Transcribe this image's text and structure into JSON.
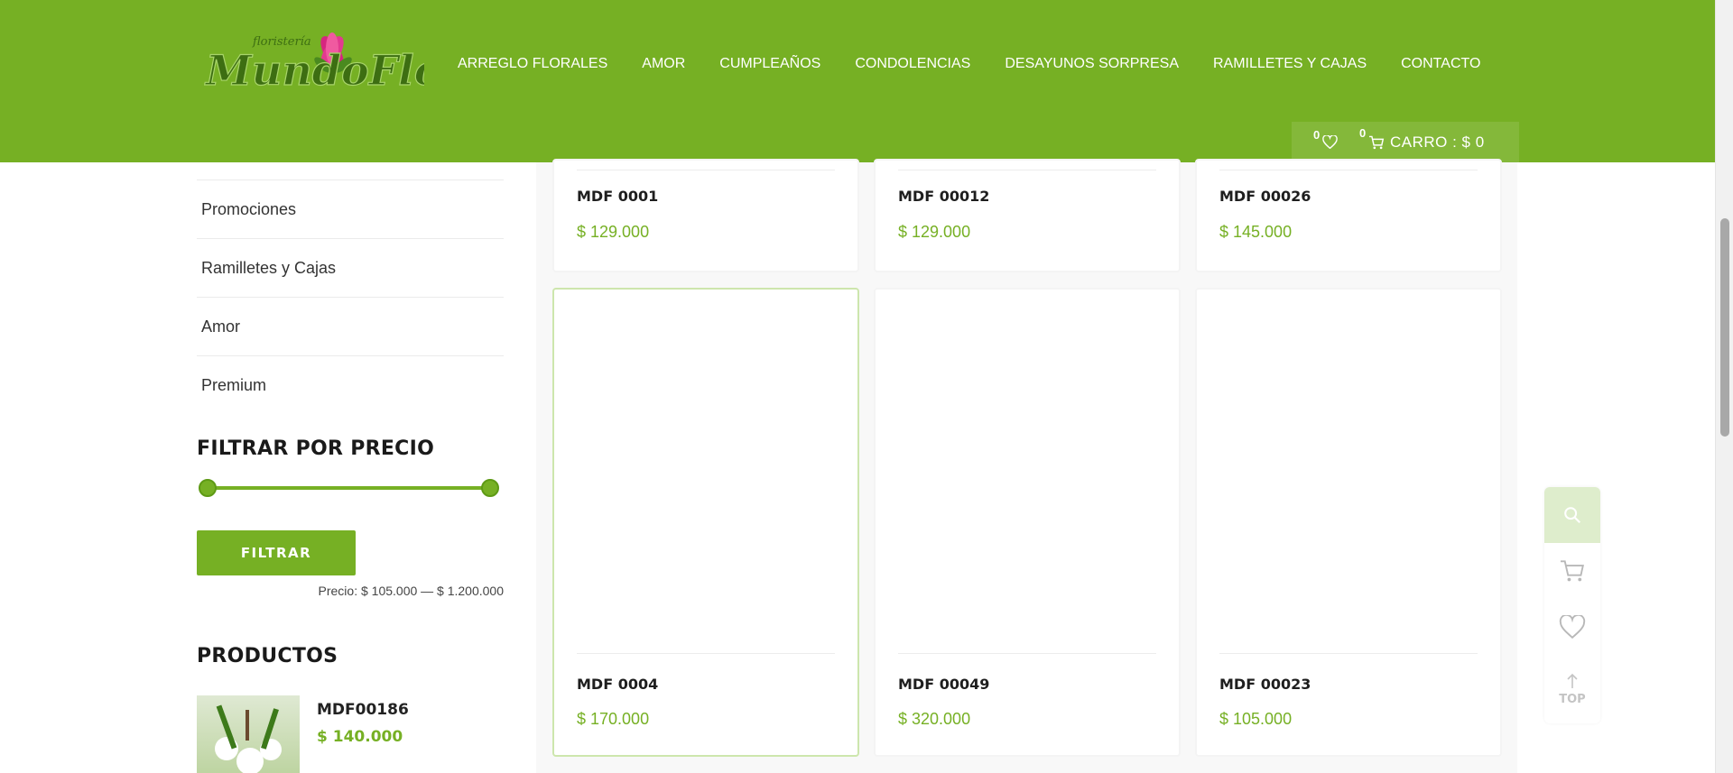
{
  "brand": {
    "logo_small_text": "floristería",
    "logo_text": "MundoFlor",
    "accent": "#76b024"
  },
  "nav": {
    "items": [
      {
        "label": "ARREGLO FLORALES"
      },
      {
        "label": "AMOR"
      },
      {
        "label": "CUMPLEAÑOS"
      },
      {
        "label": "CONDOLENCIAS"
      },
      {
        "label": "DESAYUNOS SORPRESA"
      },
      {
        "label": "RAMILLETES Y CAJAS"
      },
      {
        "label": "CONTACTO"
      }
    ]
  },
  "header": {
    "wishlist_count": "0",
    "cart_count": "0",
    "cart_label": "CARRO : $ 0"
  },
  "sidebar": {
    "categories": [
      {
        "label": "Promociones"
      },
      {
        "label": "Ramilletes y Cajas"
      },
      {
        "label": "Amor"
      },
      {
        "label": "Premium"
      }
    ],
    "price_filter": {
      "title": "FILTRAR POR PRECIO",
      "button": "FILTRAR",
      "range_text": "Precio: $ 105.000 — $ 1.200.000",
      "min_position": 0,
      "max_position": 1
    },
    "products": {
      "title": "PRODUCTOS",
      "items": [
        {
          "name": "MDF00186",
          "price": "$ 140.000"
        }
      ]
    }
  },
  "products": [
    {
      "name": "MDF 0001",
      "price": "$ 129.000"
    },
    {
      "name": "MDF 00012",
      "price": "$ 129.000"
    },
    {
      "name": "MDF 00026",
      "price": "$ 145.000"
    },
    {
      "name": "MDF 0004",
      "price": "$ 170.000"
    },
    {
      "name": "MDF 00049",
      "price": "$ 320.000"
    },
    {
      "name": "MDF 00023",
      "price": "$ 105.000"
    }
  ],
  "float_panel": {
    "top_label": "TOP"
  }
}
